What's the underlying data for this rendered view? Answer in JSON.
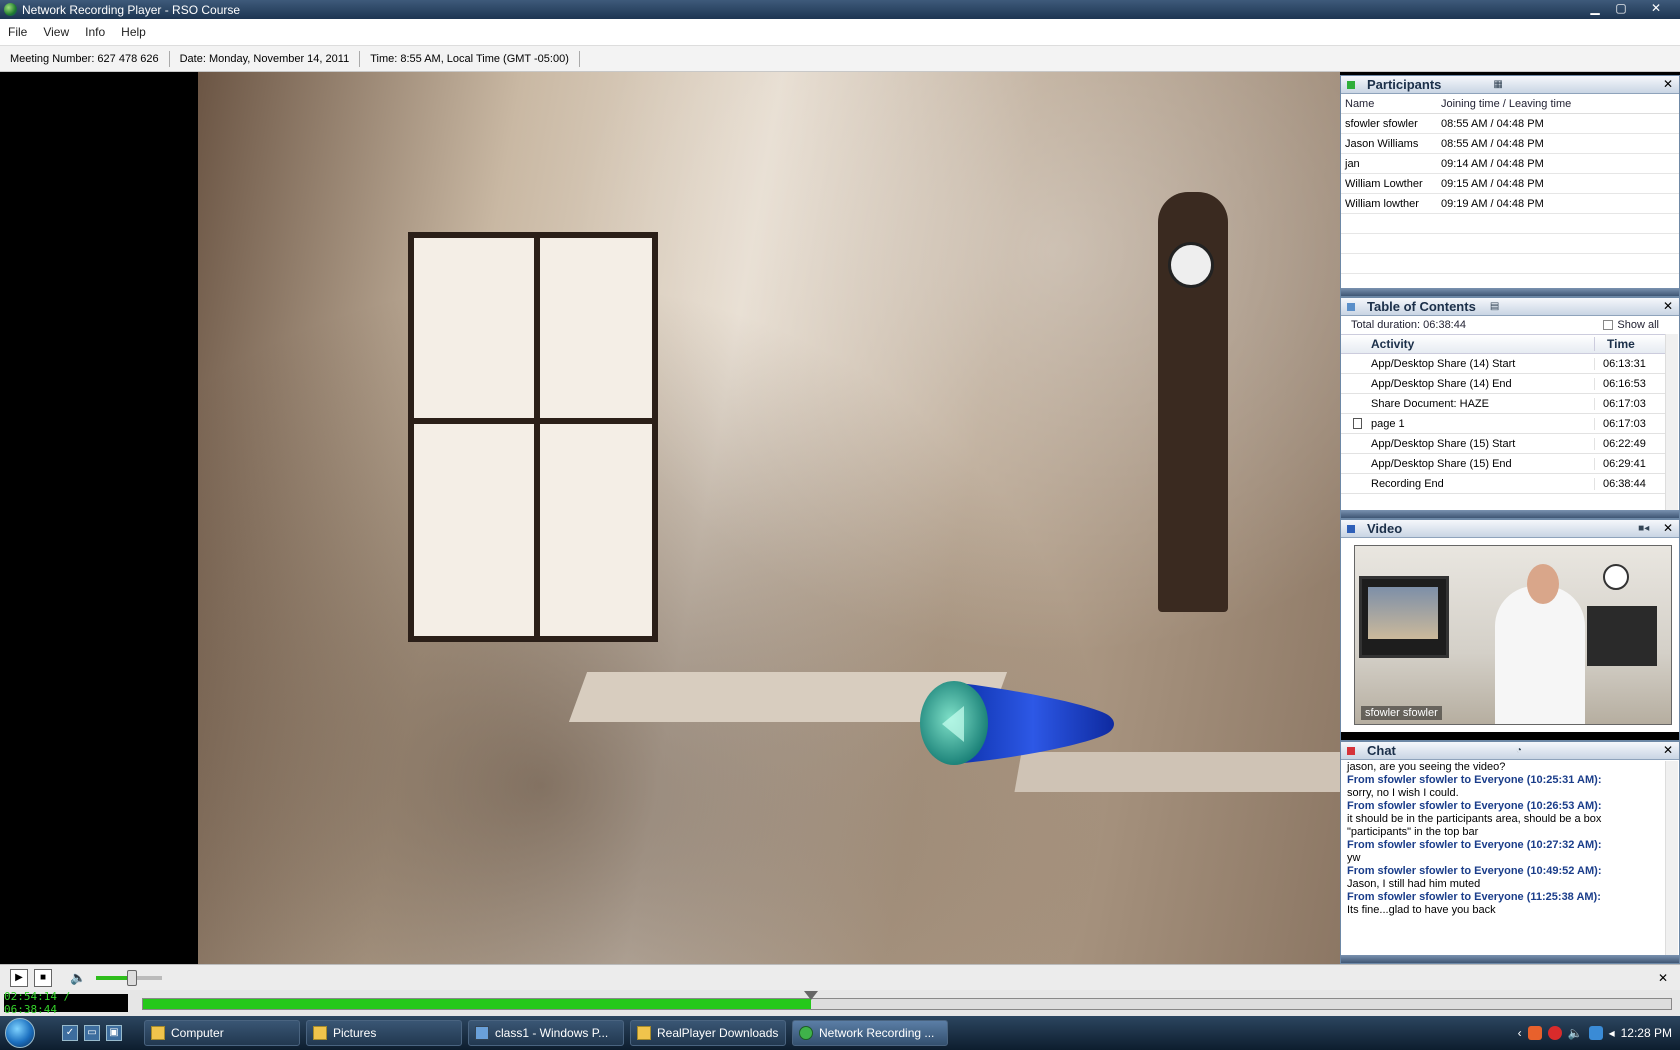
{
  "window": {
    "title": "Network Recording Player - RSO Course",
    "min": "▁",
    "max": "▢",
    "close": "✕"
  },
  "menu": [
    "File",
    "View",
    "Info",
    "Help"
  ],
  "info": {
    "meeting": "Meeting Number: 627 478 626",
    "date": "Date: Monday, November 14, 2011",
    "time": "Time: 8:55 AM, Local Time (GMT -05:00)"
  },
  "participants": {
    "title": "Participants",
    "col_name": "Name",
    "col_time": "Joining time / Leaving time",
    "rows": [
      {
        "name": "sfowler sfowler",
        "time": "08:55 AM / 04:48 PM"
      },
      {
        "name": "Jason Williams",
        "time": "08:55 AM / 04:48 PM"
      },
      {
        "name": "jan",
        "time": "09:14 AM / 04:48 PM"
      },
      {
        "name": "William Lowther",
        "time": "09:15 AM / 04:48 PM"
      },
      {
        "name": "William lowther",
        "time": "09:19 AM / 04:48 PM"
      }
    ]
  },
  "toc": {
    "title": "Table of Contents",
    "total": "Total duration: 06:38:44",
    "show_all": "Show all",
    "col_activity": "Activity",
    "col_time": "Time",
    "rows": [
      {
        "activity": "App/Desktop Share (14) Start",
        "time": "06:13:31"
      },
      {
        "activity": "App/Desktop Share (14) End",
        "time": "06:16:53"
      },
      {
        "activity": "Share Document: HAZE",
        "time": "06:17:03"
      },
      {
        "activity": "page 1",
        "time": "06:17:03"
      },
      {
        "activity": "App/Desktop Share (15) Start",
        "time": "06:22:49"
      },
      {
        "activity": "App/Desktop Share (15) End",
        "time": "06:29:41"
      },
      {
        "activity": "Recording End",
        "time": "06:38:44"
      }
    ]
  },
  "video": {
    "title": "Video",
    "caption": "sfowler sfowler"
  },
  "chat": {
    "title": "Chat",
    "lines": [
      {
        "type": "msg",
        "text": "jason, are you seeing the video?"
      },
      {
        "type": "from",
        "text": "From sfowler sfowler to Everyone (10:25:31 AM):"
      },
      {
        "type": "msg",
        "text": "sorry, no I wish I could."
      },
      {
        "type": "from",
        "text": "From sfowler sfowler to Everyone (10:26:53 AM):"
      },
      {
        "type": "msg",
        "text": "it should be in the participants area, should be a box"
      },
      {
        "type": "msg",
        "text": "\"participants\" in the top bar"
      },
      {
        "type": "from",
        "text": "From sfowler sfowler to Everyone (10:27:32 AM):"
      },
      {
        "type": "msg",
        "text": "yw"
      },
      {
        "type": "from",
        "text": "From sfowler sfowler to Everyone (10:49:52 AM):"
      },
      {
        "type": "msg",
        "text": "Jason, I still had him muted"
      },
      {
        "type": "from",
        "text": "From sfowler sfowler to Everyone (11:25:38 AM):"
      },
      {
        "type": "msg",
        "text": "Its fine...glad to have you back"
      }
    ]
  },
  "playback": {
    "timecode": "02:54:14 / 06:38:44",
    "progress": 0.437,
    "volume": 0.55
  },
  "taskbar": {
    "items": [
      "Computer",
      "Pictures",
      "class1 - Windows P...",
      "RealPlayer Downloads",
      "Network Recording ..."
    ],
    "clock": "12:28 PM"
  },
  "colors": {
    "accent_green": "#25c81a",
    "chat_from": "#1a3d8a"
  }
}
